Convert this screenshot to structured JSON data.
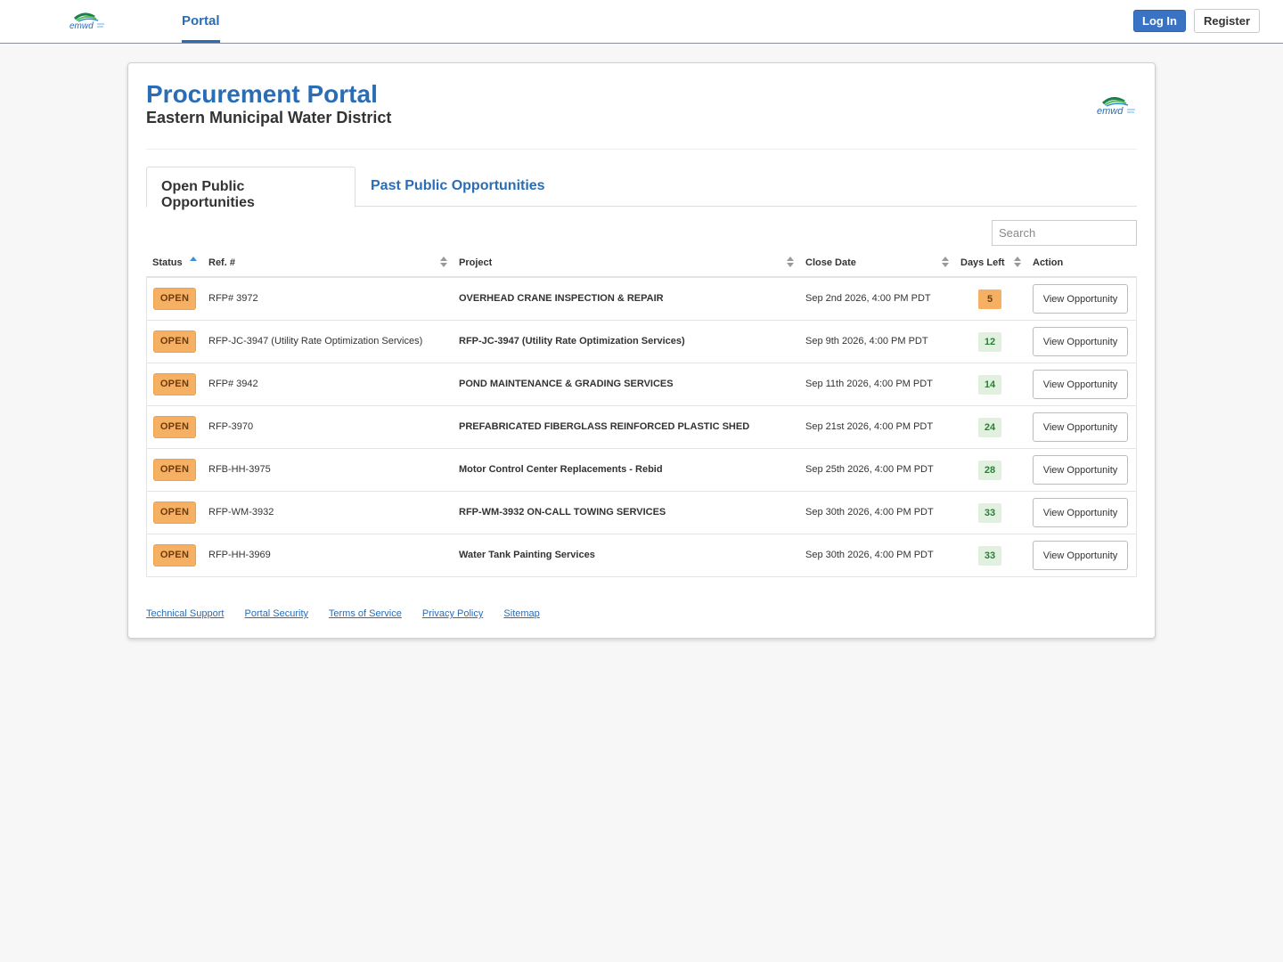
{
  "nav": {
    "logo_text": "emwd",
    "portal_tab": "Portal",
    "login_label": "Log In",
    "register_label": "Register"
  },
  "header": {
    "title": "Procurement Portal",
    "subtitle": "Eastern Municipal Water District",
    "logo_text": "emwd"
  },
  "tabs": {
    "open": "Open Public Opportunities",
    "past": "Past Public Opportunities"
  },
  "search": {
    "placeholder": "Search"
  },
  "table": {
    "headers": {
      "status": "Status",
      "ref": "Ref. #",
      "project": "Project",
      "close_date": "Close Date",
      "days_left": "Days Left",
      "action": "Action"
    },
    "rows": [
      {
        "status": "OPEN",
        "ref": "RFP# 3972",
        "project": "OVERHEAD CRANE INSPECTION & REPAIR",
        "close_date": "Sep 2nd 2026, 4:00 PM PDT",
        "days_left": "5",
        "action": "View Opportunity"
      },
      {
        "status": "OPEN",
        "ref": "RFP-JC-3947 (Utility Rate Optimization Services)",
        "project": "RFP-JC-3947 (Utility Rate Optimization Services)",
        "close_date": "Sep 9th 2026, 4:00 PM PDT",
        "days_left": "12",
        "action": "View Opportunity"
      },
      {
        "status": "OPEN",
        "ref": "RFP# 3942",
        "project": "POND MAINTENANCE & GRADING SERVICES",
        "close_date": "Sep 11th 2026, 4:00 PM PDT",
        "days_left": "14",
        "action": "View Opportunity"
      },
      {
        "status": "OPEN",
        "ref": "RFP-3970",
        "project": "PREFABRICATED FIBERGLASS REINFORCED PLASTIC SHED",
        "close_date": "Sep 21st 2026, 4:00 PM PDT",
        "days_left": "24",
        "action": "View Opportunity"
      },
      {
        "status": "OPEN",
        "ref": "RFB-HH-3975",
        "project": "Motor Control Center Replacements - Rebid",
        "close_date": "Sep 25th 2026, 4:00 PM PDT",
        "days_left": "28",
        "action": "View Opportunity"
      },
      {
        "status": "OPEN",
        "ref": "RFP-WM-3932",
        "project": "RFP-WM-3932 ON-CALL TOWING SERVICES",
        "close_date": "Sep 30th 2026, 4:00 PM PDT",
        "days_left": "33",
        "action": "View Opportunity"
      },
      {
        "status": "OPEN",
        "ref": "RFP-HH-3969",
        "project": "Water Tank Painting Services",
        "close_date": "Sep 30th 2026, 4:00 PM PDT",
        "days_left": "33",
        "action": "View Opportunity"
      }
    ]
  },
  "footer": {
    "links": [
      "Technical Support",
      "Portal Security",
      "Terms of Service",
      "Privacy Policy",
      "Sitemap"
    ]
  },
  "colors": {
    "brand_blue": "#2a6db5",
    "open_badge": "#f5b064",
    "days_green_bg": "#e2f1df",
    "days_orange_bg": "#f5b064"
  }
}
